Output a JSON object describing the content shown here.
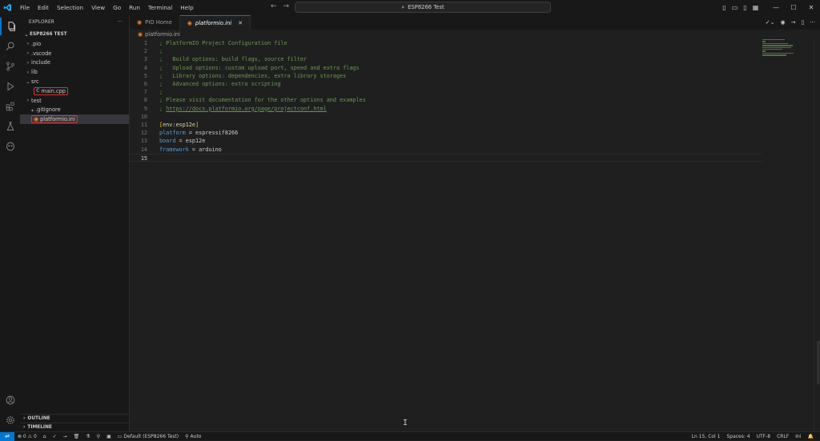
{
  "titlebar": {
    "menu": [
      "File",
      "Edit",
      "Selection",
      "View",
      "Go",
      "Run",
      "Terminal",
      "Help"
    ],
    "search_text": "ESP8266 Test"
  },
  "sidebar": {
    "header": "EXPLORER",
    "more": "···",
    "project": "ESP8266 TEST",
    "items": [
      {
        "label": ".pio",
        "type": "folder"
      },
      {
        "label": ".vscode",
        "type": "folder"
      },
      {
        "label": "include",
        "type": "folder"
      },
      {
        "label": "lib",
        "type": "folder"
      },
      {
        "label": "src",
        "type": "folder-open"
      },
      {
        "label": "main.cpp",
        "type": "cpp"
      },
      {
        "label": "test",
        "type": "folder"
      },
      {
        "label": ".gitignore",
        "type": "file"
      },
      {
        "label": "platformio.ini",
        "type": "pio"
      }
    ],
    "outline": "OUTLINE",
    "timeline": "TIMELINE"
  },
  "tabs": [
    {
      "label": "PIO Home",
      "active": false
    },
    {
      "label": "platformio.ini",
      "active": true
    }
  ],
  "breadcrumb": "platformio.ini",
  "editor": {
    "lines": [
      {
        "n": "1",
        "parts": [
          {
            "t": "; PlatformIO Project Configuration file",
            "c": "c-comment"
          }
        ]
      },
      {
        "n": "2",
        "parts": [
          {
            "t": ";",
            "c": "c-comment"
          }
        ]
      },
      {
        "n": "3",
        "parts": [
          {
            "t": ";   Build options: build flags, source filter",
            "c": "c-comment"
          }
        ]
      },
      {
        "n": "4",
        "parts": [
          {
            "t": ";   Upload options: custom upload port, speed and extra flags",
            "c": "c-comment"
          }
        ]
      },
      {
        "n": "5",
        "parts": [
          {
            "t": ";   Library options: dependencies, extra library storages",
            "c": "c-comment"
          }
        ]
      },
      {
        "n": "6",
        "parts": [
          {
            "t": ";   Advanced options: extra scripting",
            "c": "c-comment"
          }
        ]
      },
      {
        "n": "7",
        "parts": [
          {
            "t": ";",
            "c": "c-comment"
          }
        ]
      },
      {
        "n": "8",
        "parts": [
          {
            "t": "; Please visit documentation for the other options and examples",
            "c": "c-comment"
          }
        ]
      },
      {
        "n": "9",
        "parts": [
          {
            "t": "; ",
            "c": "c-comment"
          },
          {
            "t": "https://docs.platformio.org/page/projectconf.html",
            "c": "c-link"
          }
        ]
      },
      {
        "n": "10",
        "parts": []
      },
      {
        "n": "11",
        "parts": [
          {
            "t": "[",
            "c": "c-bracket"
          },
          {
            "t": "env:esp12e",
            "c": "c-section"
          },
          {
            "t": "]",
            "c": "c-bracket"
          }
        ]
      },
      {
        "n": "12",
        "parts": [
          {
            "t": "platform",
            "c": "c-key"
          },
          {
            "t": " = espressif8266",
            "c": "c-val"
          }
        ]
      },
      {
        "n": "13",
        "parts": [
          {
            "t": "board",
            "c": "c-key"
          },
          {
            "t": " = esp12e",
            "c": "c-val"
          }
        ]
      },
      {
        "n": "14",
        "parts": [
          {
            "t": "framework",
            "c": "c-key"
          },
          {
            "t": " = arduino",
            "c": "c-val"
          }
        ]
      },
      {
        "n": "15",
        "parts": []
      }
    ]
  },
  "statusbar": {
    "problems": "⊗ 0 ⚠ 0",
    "warnings_count": "0",
    "env": "Default (ESP8266 Test)",
    "auto": "Auto",
    "position": "Ln 15, Col 1",
    "spaces": "Spaces: 4",
    "encoding": "UTF-8",
    "eol": "CRLF",
    "language": "Ini"
  },
  "colors": {
    "accent": "#0078d4",
    "highlight_outline": "#e0312b",
    "comment": "#6a9955",
    "key": "#569cd6"
  }
}
